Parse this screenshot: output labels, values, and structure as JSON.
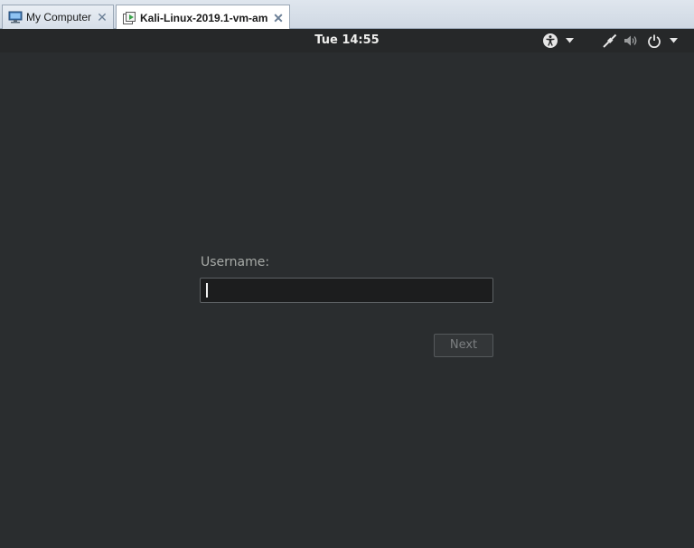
{
  "host": {
    "tabs": [
      {
        "label": "My Computer",
        "icon": "computer-icon",
        "close": "✕",
        "active": false
      },
      {
        "label": "Kali-Linux-2019.1-vm-am...",
        "icon": "vm-icon",
        "close": "✕",
        "active": true
      }
    ]
  },
  "topbar": {
    "clock": "Tue 14:55",
    "icons": [
      "accessibility-icon",
      "chevron-down-icon",
      "network-wired-icon",
      "volume-icon",
      "power-icon",
      "chevron-down-icon"
    ]
  },
  "login": {
    "username_label": "Username:",
    "username_value": "",
    "next_label": "Next"
  },
  "colors": {
    "background": "#2a2d2f",
    "topbar": "#262829",
    "text": "#eeeeec",
    "muted_text": "#a7aaa7"
  }
}
